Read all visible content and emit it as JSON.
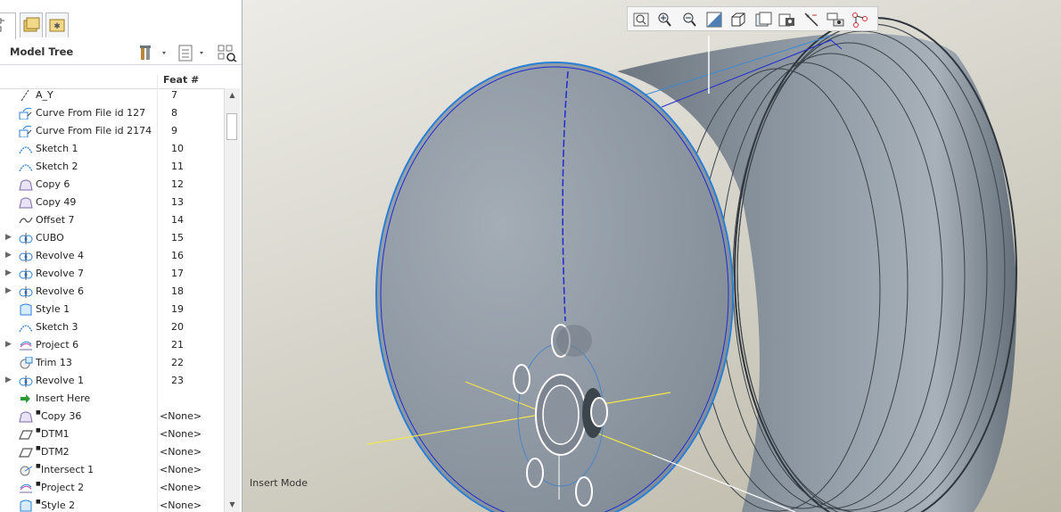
{
  "model_tree": {
    "title": "Model Tree",
    "column_feat": "Feat #",
    "rows": [
      {
        "name": "A_Y",
        "feat": "7",
        "icon": "datum-axis-icon",
        "expandable": false
      },
      {
        "name": "Curve From File id 127",
        "feat": "8",
        "icon": "curve-from-file-icon",
        "expandable": false
      },
      {
        "name": "Curve From File id 2174",
        "feat": "9",
        "icon": "curve-from-file-icon",
        "expandable": false
      },
      {
        "name": "Sketch 1",
        "feat": "10",
        "icon": "sketch-icon",
        "expandable": false
      },
      {
        "name": "Sketch 2",
        "feat": "11",
        "icon": "sketch-icon",
        "expandable": false
      },
      {
        "name": "Copy 6",
        "feat": "12",
        "icon": "copy-surface-icon",
        "expandable": false
      },
      {
        "name": "Copy 49",
        "feat": "13",
        "icon": "copy-surface-icon",
        "expandable": false
      },
      {
        "name": "Offset 7",
        "feat": "14",
        "icon": "offset-icon",
        "expandable": false
      },
      {
        "name": "CUBO",
        "feat": "15",
        "icon": "revolve-icon",
        "expandable": true
      },
      {
        "name": "Revolve 4",
        "feat": "16",
        "icon": "revolve-icon",
        "expandable": true
      },
      {
        "name": "Revolve 7",
        "feat": "17",
        "icon": "revolve-icon",
        "expandable": true
      },
      {
        "name": "Revolve 6",
        "feat": "18",
        "icon": "revolve-icon",
        "expandable": true
      },
      {
        "name": "Style 1",
        "feat": "19",
        "icon": "style-icon",
        "expandable": false
      },
      {
        "name": "Sketch 3",
        "feat": "20",
        "icon": "sketch-icon",
        "expandable": false
      },
      {
        "name": "Project 6",
        "feat": "21",
        "icon": "project-icon",
        "expandable": true
      },
      {
        "name": "Trim 13",
        "feat": "22",
        "icon": "trim-icon",
        "expandable": false
      },
      {
        "name": "Revolve 1",
        "feat": "23",
        "icon": "revolve-icon",
        "expandable": true
      },
      {
        "name": "Insert Here",
        "feat": "",
        "icon": "insert-here-arrow-icon",
        "expandable": false
      },
      {
        "name": "Copy 36",
        "feat": "<None>",
        "icon": "copy-surface-icon",
        "expandable": false
      },
      {
        "name": "DTM1",
        "feat": "<None>",
        "icon": "datum-plane-icon",
        "expandable": false
      },
      {
        "name": "DTM2",
        "feat": "<None>",
        "icon": "datum-plane-icon",
        "expandable": false
      },
      {
        "name": "Intersect 1",
        "feat": "<None>",
        "icon": "intersect-icon",
        "expandable": false
      },
      {
        "name": "Project 2",
        "feat": "<None>",
        "icon": "project-icon",
        "expandable": false
      },
      {
        "name": "Style 2",
        "feat": "<None>",
        "icon": "style-icon",
        "expandable": false
      }
    ]
  },
  "viewport": {
    "status": "Insert Mode",
    "toolbar_icons": [
      "refit-icon",
      "zoom-in-icon",
      "zoom-out-icon",
      "repaint-icon",
      "display-style-icon",
      "saved-orientations-icon",
      "view-manager-icon",
      "datum-display-icon",
      "annotation-display-icon",
      "spin-center-icon"
    ]
  },
  "colors": {
    "accent": "#2a7fd4",
    "viewport_bg": "#d7d5cb",
    "model_gray": "#8c96a1"
  }
}
